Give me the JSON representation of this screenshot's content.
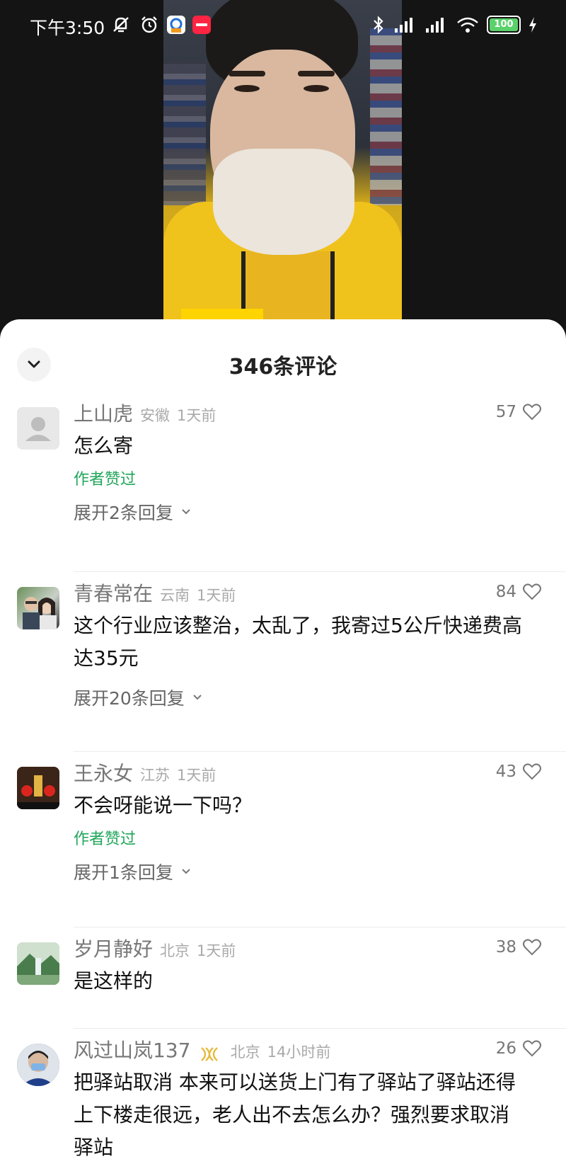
{
  "status_bar": {
    "time": "下午3:50",
    "battery": "100"
  },
  "sheet": {
    "title": "346条评论"
  },
  "comments": [
    {
      "username": "上山虎",
      "location": "安徽",
      "time": "1天前",
      "text": "怎么寄",
      "author_liked": "作者赞过",
      "expand": "展开2条回复",
      "likes": "57"
    },
    {
      "username": "青春常在",
      "location": "云南",
      "time": "1天前",
      "text": "这个行业应该整治，太乱了，我寄过5公斤快递费高达35元",
      "expand": "展开20条回复",
      "likes": "84"
    },
    {
      "username": "王永女",
      "location": "江苏",
      "time": "1天前",
      "text": "不会呀能说一下吗？",
      "author_liked": "作者赞过",
      "expand": "展开1条回复",
      "likes": "43"
    },
    {
      "username": "岁月静好",
      "location": "北京",
      "time": "1天前",
      "text": "是这样的",
      "likes": "38"
    },
    {
      "username": "风过山岚137",
      "location": "北京",
      "time": "14小时前",
      "text": "把驿站取消 本来可以送货上门有了驿站了驿站还得上下楼走很远，老人出不去怎么办？强烈要求取消驿站",
      "likes": "26"
    }
  ],
  "colors": {
    "author_liked": "#1fa659",
    "sheet_bg": "#ffffff",
    "video_bg": "#141414"
  }
}
